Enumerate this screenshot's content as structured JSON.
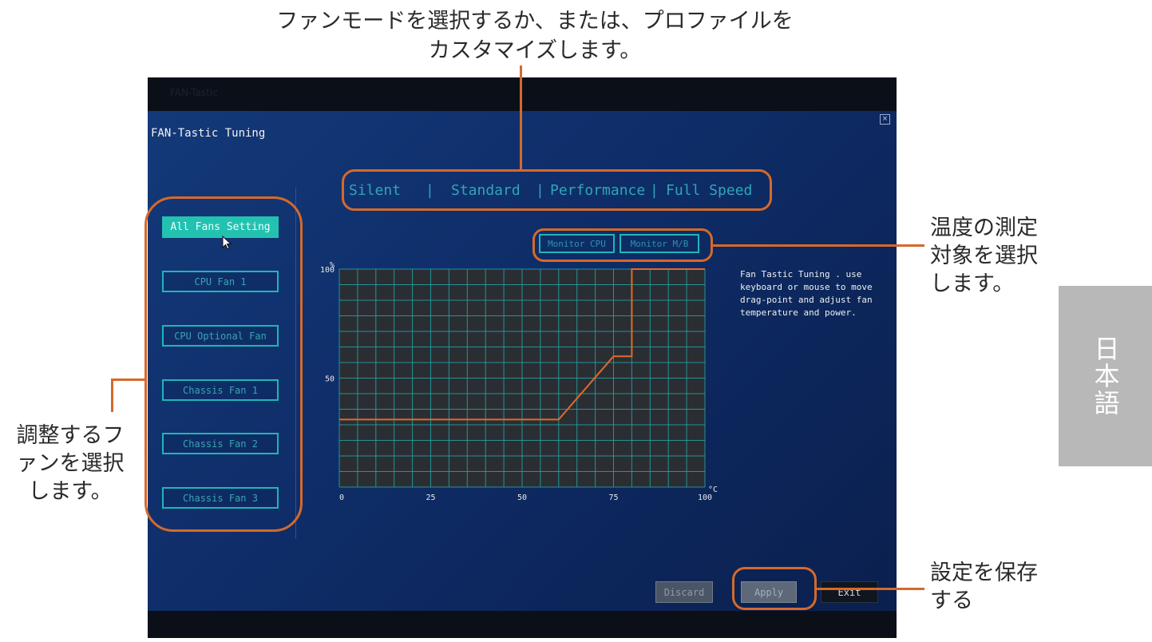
{
  "annotations": {
    "top_line1": "ファンモードを選択するか、または、プロファイルを",
    "top_line2": "カスタマイズします。",
    "right1_line1": "温度の測定",
    "right1_line2": "対象を選択",
    "right1_line3": "します。",
    "left_line1": "調整するフ",
    "left_line2": "ァンを選択",
    "left_line3": "します。",
    "right2_line1": "設定を保存",
    "right2_line2": "する"
  },
  "language_tab": "日本語",
  "bios": {
    "title": "FAN-Tastic Tuning",
    "close_symbol": "×",
    "fans": [
      "All Fans Setting",
      "CPU Fan 1",
      "CPU Optional Fan",
      "Chassis Fan 1",
      "Chassis Fan 2",
      "Chassis Fan 3"
    ],
    "active_fan": "All Fans Setting",
    "modes": [
      "Silent",
      "Standard",
      "Performance",
      "Full Speed"
    ],
    "monitor_buttons": [
      "Monitor CPU",
      "Monitor M/B"
    ],
    "help_text": "Fan Tastic Tuning . use keyboard or mouse to move drag-point and adjust fan temperature and power.",
    "actions": {
      "discard": "Discard",
      "apply": "Apply",
      "exit": "Exit"
    }
  },
  "chart_data": {
    "type": "line",
    "title": "",
    "xlabel": "°C",
    "ylabel": "%",
    "xlim": [
      0,
      100
    ],
    "ylim": [
      0,
      100
    ],
    "x_ticks": [
      "0",
      "25",
      "50",
      "75",
      "100"
    ],
    "y_ticks": [
      "100",
      "50"
    ],
    "grid": true,
    "line_color": "#e06a2a",
    "grid_color": "#23a5a5",
    "series": [
      {
        "x": [
          0,
          60,
          75,
          80,
          80,
          100
        ],
        "y": [
          31,
          31,
          60,
          60,
          100,
          100
        ]
      }
    ]
  }
}
